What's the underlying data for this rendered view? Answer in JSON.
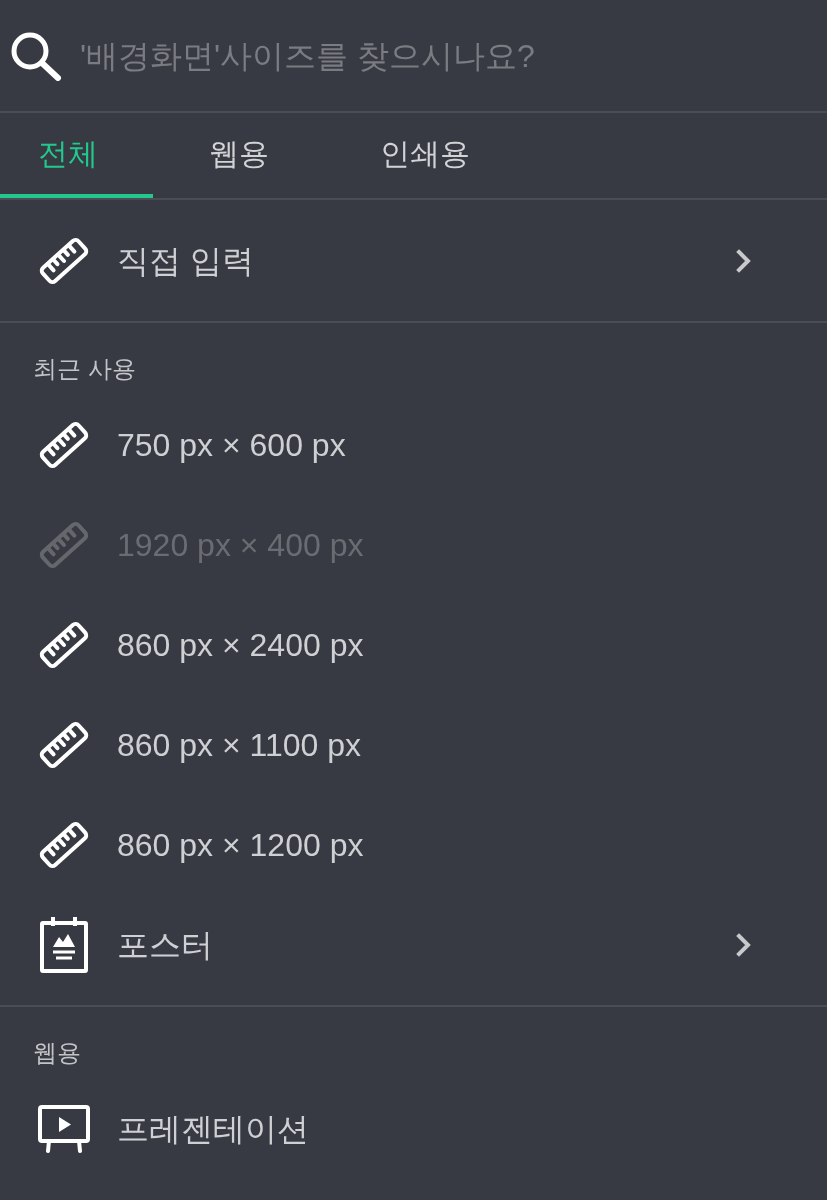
{
  "search": {
    "placeholder": "'배경화면'사이즈를 찾으시나요?"
  },
  "tabs": [
    {
      "label": "전체",
      "selected": true
    },
    {
      "label": "웹용",
      "selected": false
    },
    {
      "label": "인쇄용",
      "selected": false
    }
  ],
  "custom_entry": {
    "label": "직접 입력",
    "submenu": true
  },
  "sections": [
    {
      "heading": "최근 사용",
      "items": [
        {
          "kind": "size",
          "label": "750 px × 600 px",
          "disabled": false,
          "submenu": false
        },
        {
          "kind": "size",
          "label": "1920 px × 400 px",
          "disabled": true,
          "submenu": false
        },
        {
          "kind": "size",
          "label": "860 px × 2400 px",
          "disabled": false,
          "submenu": false
        },
        {
          "kind": "size",
          "label": "860 px × 1100 px",
          "disabled": false,
          "submenu": false
        },
        {
          "kind": "size",
          "label": "860 px × 1200 px",
          "disabled": false,
          "submenu": false
        },
        {
          "kind": "poster",
          "label": "포스터",
          "disabled": false,
          "submenu": true
        }
      ]
    },
    {
      "heading": "웹용",
      "items": [
        {
          "kind": "presentation",
          "label": "프레젠테이션",
          "disabled": false,
          "submenu": false
        }
      ]
    }
  ]
}
